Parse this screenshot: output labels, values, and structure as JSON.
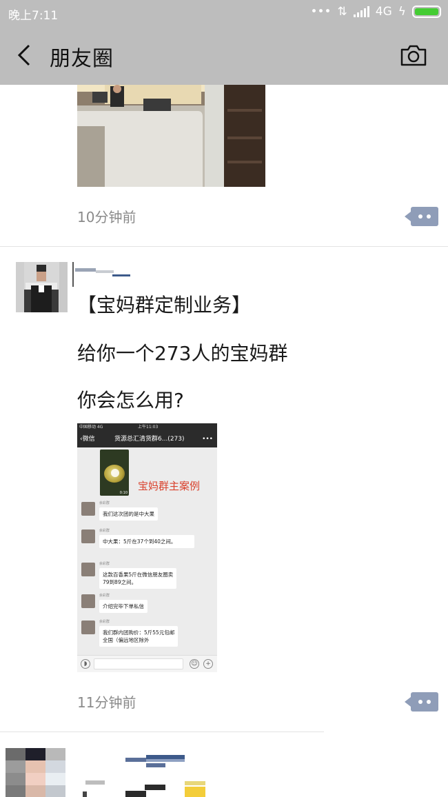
{
  "status_bar": {
    "time": "晚上7:11",
    "network": "4G",
    "battery_color": "#44cc33"
  },
  "nav": {
    "title": "朋友圈",
    "back_icon": "chevron-left-icon",
    "camera_icon": "camera-icon"
  },
  "posts": [
    {
      "time": "10分钟前"
    },
    {
      "lines": [
        "【宝妈群定制业务】",
        "给你一个273人的宝妈群",
        "你会怎么用?"
      ],
      "time": "11分钟前",
      "image": {
        "status_left": "中国移动  4G",
        "status_time": "上午11:03",
        "back_label": "微信",
        "chat_title": "货源总汇清货群6...(273)",
        "more": "•••",
        "video_duration": "0:10",
        "overlay_text": "宝妈群主案例",
        "sender": "余彩群",
        "messages": [
          [
            "我们这次团的是中大果"
          ],
          [
            "中大果：5斤在37个到40之间。"
          ],
          [
            "这款百香果5斤在微信朋友圈卖",
            "79到89之间。"
          ],
          [
            "介绍完毕下单私信"
          ],
          [
            "我们群内团购价：5斤55元包邮",
            "全国（偏远地区除外"
          ]
        ]
      }
    }
  ],
  "accent_color": "#8f9db8"
}
